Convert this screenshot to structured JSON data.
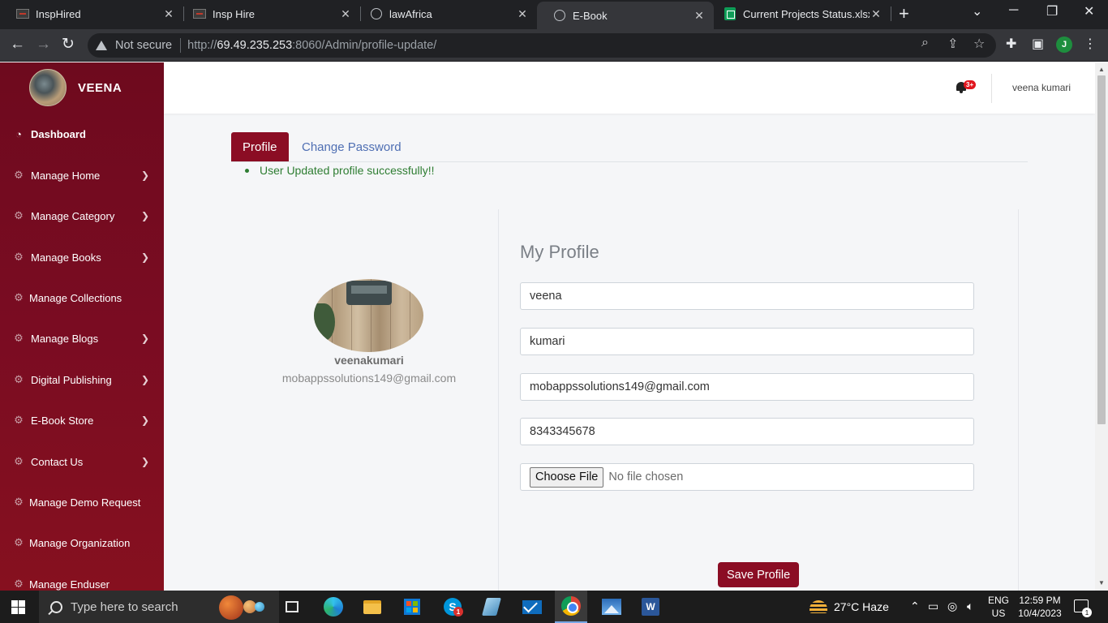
{
  "browser": {
    "tabs": [
      {
        "title": "InspHired",
        "icon": "insp-favicon"
      },
      {
        "title": "Insp Hire",
        "icon": "insp-favicon"
      },
      {
        "title": "lawAfrica",
        "icon": "globe-favicon"
      },
      {
        "title": "E-Book",
        "icon": "globe-favicon",
        "active": true
      },
      {
        "title": "Current Projects Status.xlsx",
        "icon": "sheets-favicon"
      }
    ],
    "security_label": "Not secure",
    "url_prefix": "http://",
    "url_host": "69.49.235.253",
    "url_path": ":8060/Admin/profile-update/",
    "profile_initial": "J"
  },
  "sidebar": {
    "brand_name": "VEENA",
    "items": [
      {
        "label": "Dashboard",
        "icon": "dashboard-icon",
        "active": true,
        "has_chevron": false
      },
      {
        "label": "Manage Home",
        "icon": "gear-icon",
        "has_chevron": true
      },
      {
        "label": "Manage Category",
        "icon": "gear-icon",
        "has_chevron": true
      },
      {
        "label": "Manage Books",
        "icon": "gear-icon",
        "has_chevron": true
      },
      {
        "label": "Manage Collections",
        "icon": "gear-icon",
        "has_chevron": false
      },
      {
        "label": "Manage Blogs",
        "icon": "gear-icon",
        "has_chevron": true
      },
      {
        "label": "Digital Publishing",
        "icon": "gear-icon",
        "has_chevron": true
      },
      {
        "label": "E-Book Store",
        "icon": "gear-icon",
        "has_chevron": true
      },
      {
        "label": "Contact Us",
        "icon": "gear-icon",
        "has_chevron": true
      },
      {
        "label": "Manage Demo Request",
        "icon": "gear-icon",
        "has_chevron": false
      },
      {
        "label": "Manage Organization",
        "icon": "gear-icon",
        "has_chevron": false
      },
      {
        "label": "Manage Enduser",
        "icon": "gear-icon",
        "has_chevron": false
      }
    ]
  },
  "header": {
    "notification_badge": "3+",
    "user_name": "veena kumari"
  },
  "main": {
    "tabs": [
      {
        "label": "Profile",
        "active": true
      },
      {
        "label": "Change Password",
        "active": false
      }
    ],
    "success_message": "User Updated profile successfully!!",
    "profile_card": {
      "username": "veenakumari",
      "email": "mobappssolutions149@gmail.com"
    },
    "form": {
      "heading": "My Profile",
      "first_name": "veena",
      "last_name": "kumari",
      "email": "mobappssolutions149@gmail.com",
      "phone": "8343345678",
      "file_button": "Choose File",
      "file_status": "No file chosen",
      "save_label": "Save Profile"
    }
  },
  "taskbar": {
    "search_placeholder": "Type here to search",
    "skype_badge": "1",
    "weather": "27°C  Haze",
    "lang_line1": "ENG",
    "lang_line2": "US",
    "time": "12:59 PM",
    "date": "10/4/2023",
    "notification_count": "1"
  },
  "colors": {
    "brand": "#8b0d24",
    "sidebar_top": "#6e0a1e",
    "success": "#2e7d32",
    "link": "#4f6fb3"
  }
}
